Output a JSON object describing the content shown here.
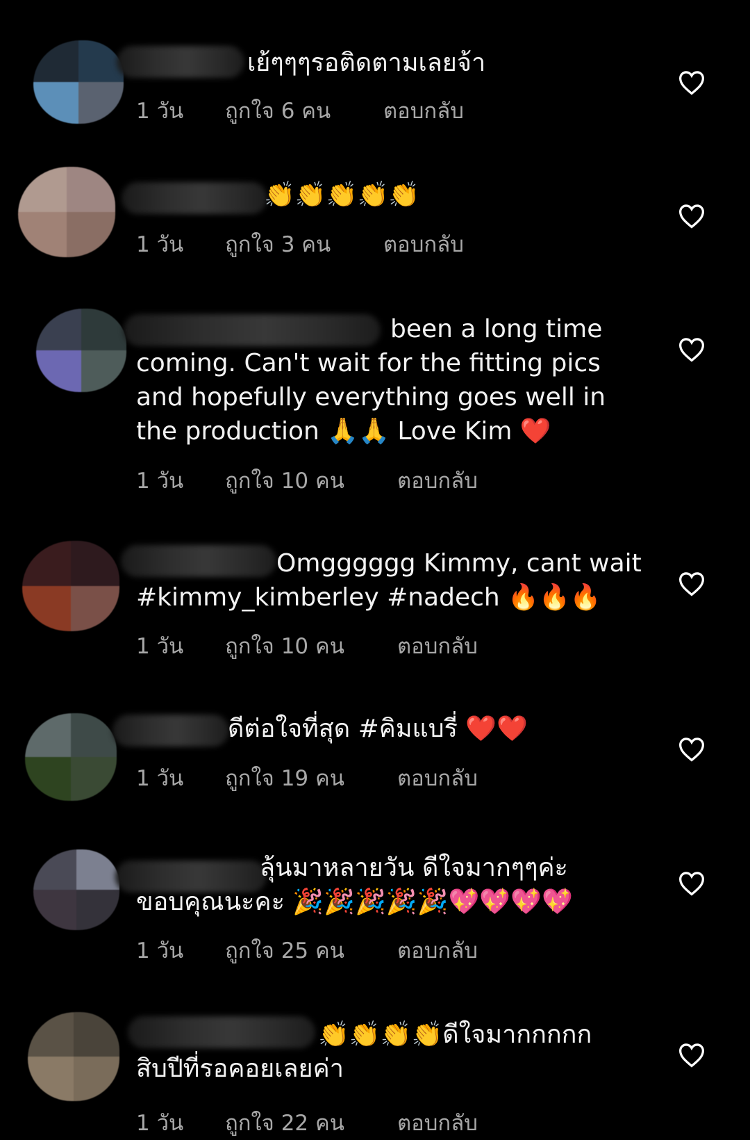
{
  "colors": {
    "background": "#000000",
    "text": "#f2f2f2",
    "meta": "#a8a8a8",
    "heart_outline": "#ffffff"
  },
  "comments": [
    {
      "text": "เย้ๆๆๆรอติดตามเลยจ้า",
      "time": "1 วัน",
      "likes": "ถูกใจ 6 คน",
      "reply": "ตอบกลับ",
      "like_icon": "heart-outline-icon"
    },
    {
      "text": "👏👏👏👏👏",
      "time": "1 วัน",
      "likes": "ถูกใจ 3 คน",
      "reply": "ตอบกลับ",
      "like_icon": "heart-outline-icon"
    },
    {
      "text": "been a long time\ncoming. Can't wait for the fitting pics\nand hopefully everything goes well in\nthe production 🙏🙏 Love Kim ❤️",
      "time": "1 วัน",
      "likes": "ถูกใจ 10 คน",
      "reply": "ตอบกลับ",
      "like_icon": "heart-outline-icon"
    },
    {
      "text": "Omgggggg Kimmy, cant wait\n#kimmy_kimberley #nadech 🔥🔥🔥",
      "time": "1 วัน",
      "likes": "ถูกใจ 10 คน",
      "reply": "ตอบกลับ",
      "like_icon": "heart-outline-icon"
    },
    {
      "text": "ดีต่อใจที่สุด #คิมแบรี่ ❤️❤️",
      "time": "1 วัน",
      "likes": "ถูกใจ 19 คน",
      "reply": "ตอบกลับ",
      "like_icon": "heart-outline-icon"
    },
    {
      "text": "ลุ้นมาหลายวัน ดีใจมากๆๆค่ะ\nขอบคุณนะคะ 🎉🎉🎉🎉🎉💖💖💖💖",
      "time": "1 วัน",
      "likes": "ถูกใจ 25 คน",
      "reply": "ตอบกลับ",
      "like_icon": "heart-outline-icon"
    },
    {
      "text": "👏👏👏👏ดีใจมากกกกก\nสิบปีที่รอคอยเลยค่า",
      "time": "1 วัน",
      "likes": "ถูกใจ 22 คน",
      "reply": "ตอบกลับ",
      "like_icon": "heart-outline-icon"
    }
  ]
}
